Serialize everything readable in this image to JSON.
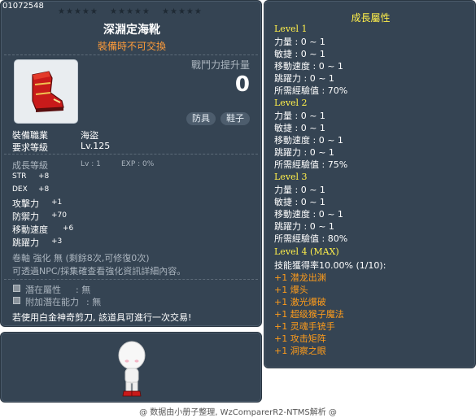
{
  "item": {
    "id": "01072548",
    "name": "深淵定海靴",
    "untradeable": "裝備時不可交換",
    "power_label": "戰鬥力提升量",
    "power_value": "0",
    "tags": [
      "防具",
      "鞋子"
    ],
    "job_label": "裝備職業",
    "job_value": "海盜",
    "req_label": "要求等級",
    "req_value": "Lv.125",
    "growth_label": "成長等級",
    "growth_lv": "Lv : 1",
    "growth_exp": "EXP : 0%",
    "stats": [
      {
        "label": "STR",
        "value": "+8"
      },
      {
        "label": "DEX",
        "value": "+8"
      },
      {
        "label": "攻擊力",
        "value": "+1"
      },
      {
        "label": "防禦力",
        "value": "+70"
      },
      {
        "label": "移動速度",
        "value": "+6"
      },
      {
        "label": "跳躍力",
        "value": "+3"
      }
    ],
    "scroll_text": "卷軸 強化 無 (剩餘8次,可修復0次)",
    "enhance_hint": "可透過NPC/採集確查看強化資訊詳細內容。",
    "potential_label": "潛在屬性",
    "potential_value": ": 無",
    "addl_potential_label": "附加潛在能力",
    "addl_potential_value": ": 無",
    "scissors_note": "若使用白金神奇剪刀, 該道具可進行一次交易!"
  },
  "growth": {
    "title": "成長屬性",
    "levels": [
      {
        "name": "Level 1",
        "lines": [
          "力量 : 0 ~ 1",
          "敏捷 : 0 ~ 1",
          "移動速度 : 0 ~ 1",
          "跳躍力 : 0 ~ 1",
          "所需經驗值 : 70%"
        ]
      },
      {
        "name": "Level 2",
        "lines": [
          "力量 : 0 ~ 1",
          "敏捷 : 0 ~ 1",
          "移動速度 : 0 ~ 1",
          "跳躍力 : 0 ~ 1",
          "所需經驗值 : 75%"
        ]
      },
      {
        "name": "Level 3",
        "lines": [
          "力量 : 0 ~ 1",
          "敏捷 : 0 ~ 1",
          "移動速度 : 0 ~ 1",
          "跳躍力 : 0 ~ 1",
          "所需經驗值 : 80%"
        ]
      }
    ],
    "level4": {
      "name": "Level 4 (MAX)",
      "rate": "技能獲得率10.00% (1/10):",
      "skills": [
        "+1 潜龙出渊",
        "+1 爆头",
        "+1 激光爆破",
        "+1 超级猴子魔法",
        "+1 灵魂手铳手",
        "+1 攻击矩阵",
        "+1 洞察之眼"
      ]
    }
  },
  "footer": "@ 数据由小册子整理, WzComparerR2-NTMS解析 @",
  "colors": {
    "panel": "#354453",
    "gold": "#ffef4a",
    "orange": "#ff9c3a",
    "skill": "#ff9c1a"
  }
}
